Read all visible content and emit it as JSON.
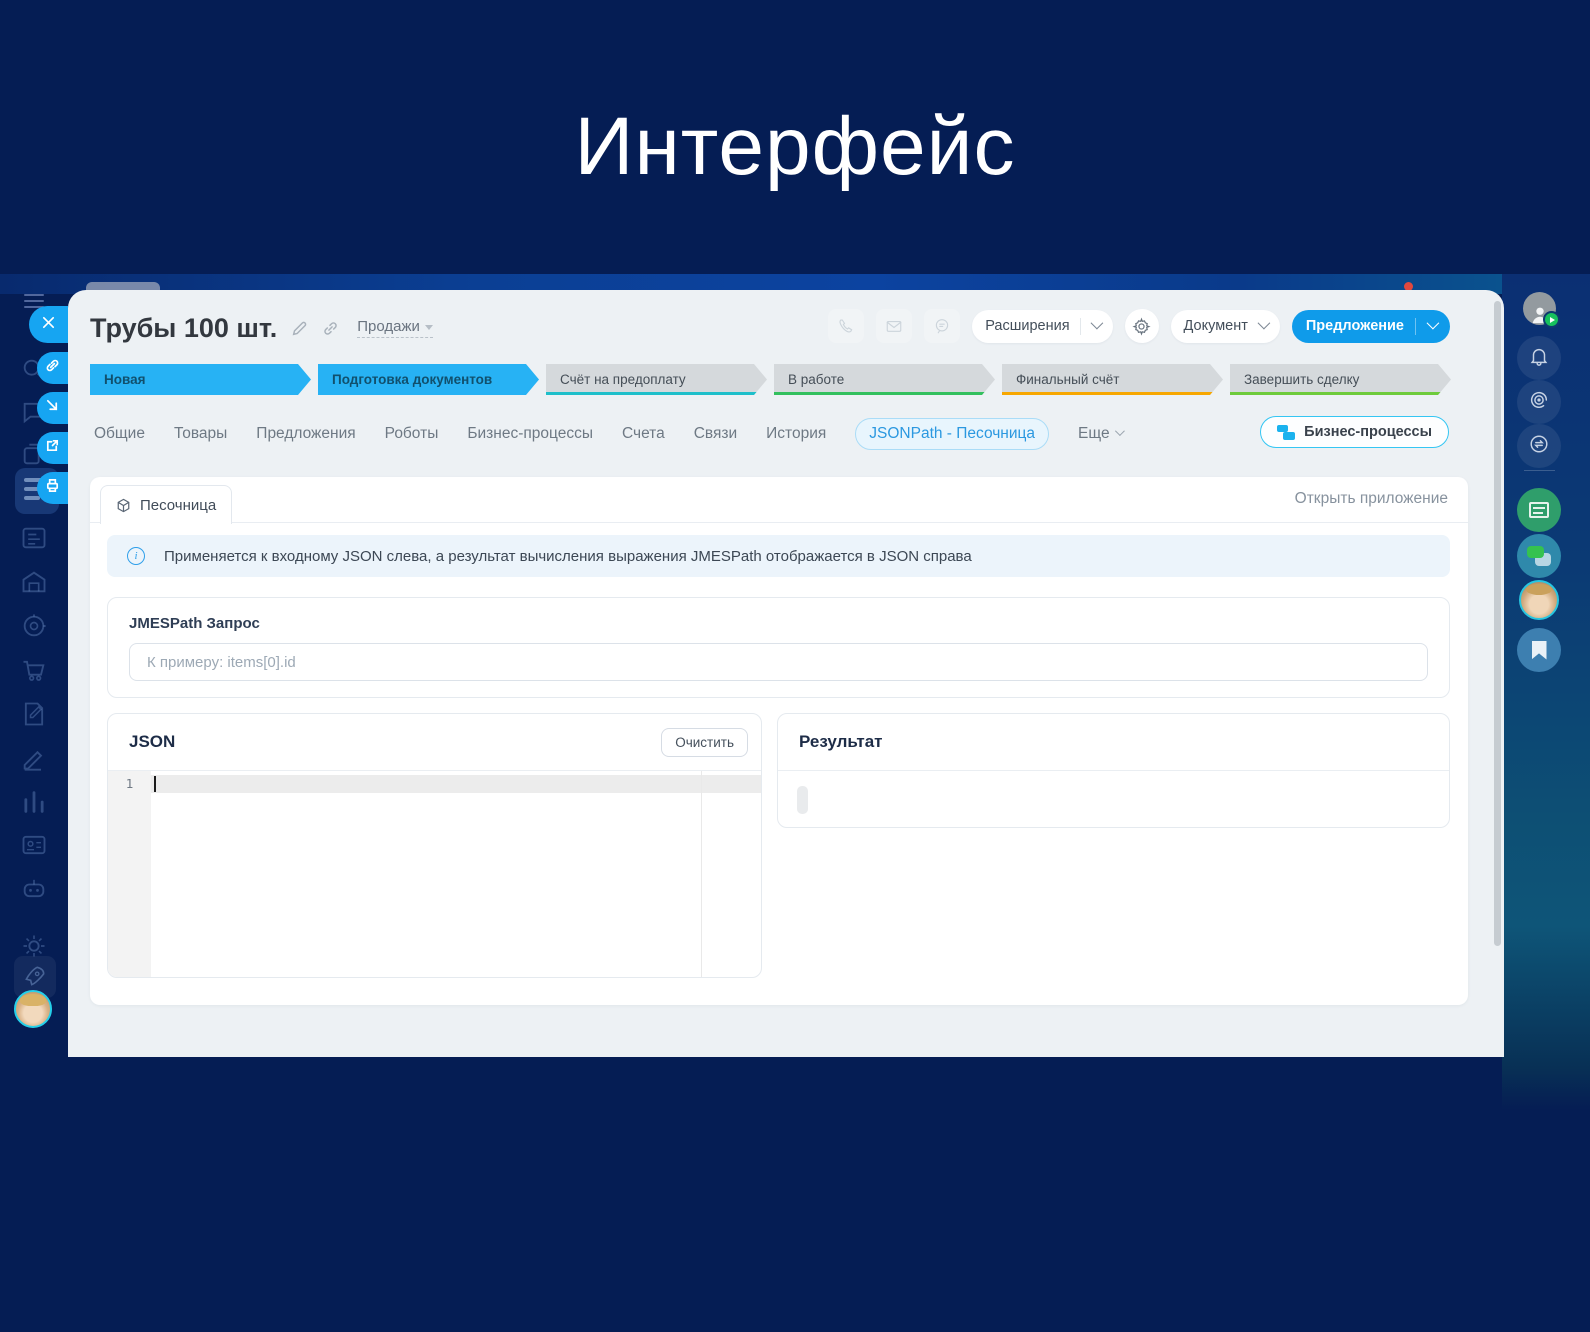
{
  "page": {
    "title": "Интерфейс"
  },
  "deal": {
    "title": "Трубы 100 шт.",
    "pipeline_label": "Продажи",
    "toolbar": {
      "extensions": "Расширения",
      "document": "Документ",
      "offer": "Предложение"
    },
    "stages": [
      {
        "label": "Новая",
        "state": "done"
      },
      {
        "label": "Подготовка документов",
        "state": "done"
      },
      {
        "label": "Счёт на предоплату",
        "state": "future",
        "underline_color": "#1ebfca"
      },
      {
        "label": "В работе",
        "state": "future",
        "underline_color": "#33c05e"
      },
      {
        "label": "Финальный счёт",
        "state": "future",
        "underline_color": "#f7a700"
      },
      {
        "label": "Завершить сделку",
        "state": "future",
        "underline_color": "#6ecb3c"
      }
    ],
    "tabs": [
      "Общие",
      "Товары",
      "Предложения",
      "Роботы",
      "Бизнес-процессы",
      "Счета",
      "Связи",
      "История",
      "JSONPath - Песочница",
      "Еще"
    ],
    "active_tab": "JSONPath - Песочница",
    "bp_button": "Бизнес-процессы"
  },
  "app": {
    "tab": "Песочница",
    "open_app": "Открыть приложение",
    "info": "Применяется к входному JSON слева, а результат вычисления выражения JMESPath отображается в JSON справа",
    "query": {
      "label": "JMESPath Запрос",
      "placeholder": "К примеру: items[0].id",
      "value": ""
    },
    "json_panel": {
      "title": "JSON",
      "clear": "Очистить",
      "line_number": "1",
      "content": ""
    },
    "result_panel": {
      "title": "Результат"
    }
  },
  "icons": {
    "slider": [
      "close-icon",
      "copy-link-icon",
      "collapse-icon",
      "open-new-window-icon",
      "print-icon"
    ],
    "toolbar_ghost": [
      "phone-icon",
      "mail-icon",
      "chat-search-icon"
    ],
    "right_rail": [
      "account-avatar",
      "bell-icon",
      "target-icon",
      "chat-transfer-icon",
      "news-icon",
      "messenger-icon",
      "support-avatar",
      "bookmark-icon"
    ]
  },
  "colors": {
    "background_navy": "#051d54",
    "accent_blue": "#0f9bea",
    "stage_done_blue": "#27b2f4",
    "stage_future_gray": "#d5d9dc",
    "stage_underlines": [
      "#1ebfca",
      "#33c05e",
      "#f7a700",
      "#6ecb3c"
    ],
    "active_tab_text": "#2b98e0",
    "active_tab_bg": "#e8f5fd",
    "bp_button_border": "#35c6f3",
    "info_banner_bg": "#ecf4fb",
    "overlay_bg": "#edf1f4"
  }
}
